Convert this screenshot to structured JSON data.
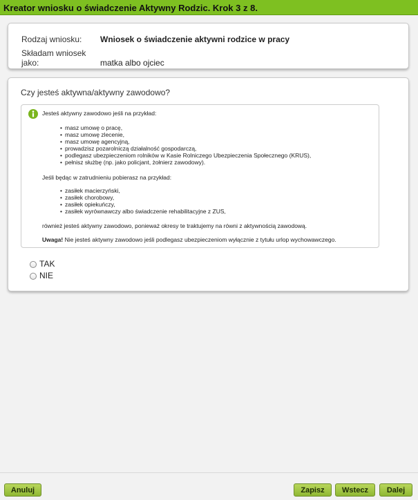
{
  "header": {
    "title": "Kreator wniosku o świadczenie Aktywny Rodzic. Krok 3 z 8."
  },
  "summary": {
    "type_label": "Rodzaj wniosku:",
    "type_value": "Wniosek o świadczenie aktywni rodzice w pracy",
    "applicant_label": "Składam wniosek jako:",
    "applicant_value": "matka albo ojciec"
  },
  "question": {
    "text": "Czy jesteś aktywna/aktywny zawodowo?",
    "info": {
      "icon": "info-icon",
      "intro": "Jesteś aktywny zawodowo jeśli na przykład:",
      "list1": [
        "masz umowę o pracę,",
        "masz umowę zlecenie,",
        "masz umowę agencyjną,",
        "prowadzisz pozarolniczą działalność gospodarczą,",
        "podlegasz ubezpieczeniom rolników w Kasie Rolniczego Ubezpieczenia Społecznego (KRUS),",
        "pełnisz służbę (np. jako policjant, żołnierz zawodowy)."
      ],
      "intro2": "Jeśli będąc w zatrudnieniu pobierasz na przykład:",
      "list2": [
        "zasiłek macierzyński,",
        "zasiłek chorobowy,",
        "zasiłek opiekuńczy,",
        "zasiłek wyrównawczy albo świadczenie rehabilitacyjne z ZUS,"
      ],
      "conclusion": "również jesteś aktywny zawodowo, ponieważ okresy te traktujemy na równi z aktywnością zawodową.",
      "warning_bold": "Uwaga!",
      "warning_text": " Nie jesteś aktywny zawodowo jeśli podlegasz ubezpieczeniom wyłącznie z tytułu urlop wychowawczego."
    },
    "options": [
      {
        "label": "TAK",
        "selected": false
      },
      {
        "label": "NIE",
        "selected": false
      }
    ]
  },
  "footer": {
    "cancel_label": "Anuluj",
    "save_label": "Zapisz",
    "back_label": "Wstecz",
    "next_label": "Dalej"
  },
  "colors": {
    "header_green": "#7ec021",
    "button_green": "#a6c947"
  }
}
